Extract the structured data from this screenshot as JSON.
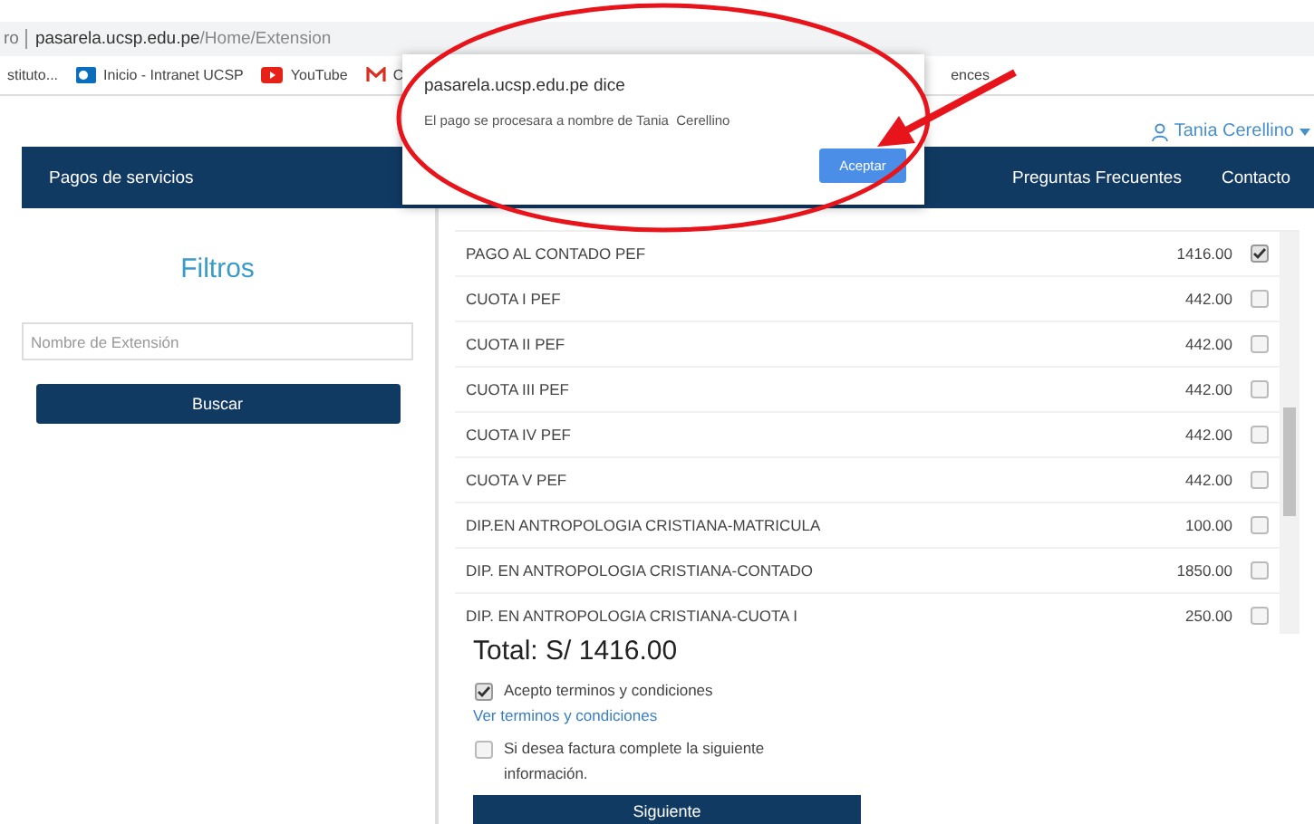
{
  "browser": {
    "tab_fragment": "ro",
    "url_host": "pasarela.ucsp.edu.pe",
    "url_path": "/Home/Extension",
    "bookmarks": [
      {
        "label": "stituto...",
        "kind": "plain"
      },
      {
        "label": "Inicio - Intranet UCSP",
        "kind": "intranet"
      },
      {
        "label": "YouTube",
        "kind": "youtube"
      },
      {
        "label": "C",
        "kind": "gmail"
      },
      {
        "label": "ences",
        "kind": "plain"
      }
    ]
  },
  "user": {
    "name": "Tania Cerellino"
  },
  "nav": {
    "left": "Pagos de servicios",
    "right": [
      "Preguntas Frecuentes",
      "Contacto"
    ]
  },
  "filters": {
    "title": "Filtros",
    "search": {
      "placeholder": "Nombre de Extensión"
    },
    "button": "Buscar"
  },
  "items": [
    {
      "name": "PAGO AL CONTADO PEF",
      "amount": "1416.00",
      "checked": true
    },
    {
      "name": "CUOTA I PEF",
      "amount": "442.00",
      "checked": false
    },
    {
      "name": "CUOTA II PEF",
      "amount": "442.00",
      "checked": false
    },
    {
      "name": "CUOTA III PEF",
      "amount": "442.00",
      "checked": false
    },
    {
      "name": "CUOTA IV PEF",
      "amount": "442.00",
      "checked": false
    },
    {
      "name": "CUOTA V PEF",
      "amount": "442.00",
      "checked": false
    },
    {
      "name": "DIP.EN ANTROPOLOGIA CRISTIANA-MATRICULA",
      "amount": "100.00",
      "checked": false
    },
    {
      "name": "DIP. EN ANTROPOLOGIA CRISTIANA-CONTADO",
      "amount": "1850.00",
      "checked": false
    },
    {
      "name": "DIP. EN ANTROPOLOGIA CRISTIANA-CUOTA I",
      "amount": "250.00",
      "checked": false
    }
  ],
  "total": "Total: S/ 1416.00",
  "terms": {
    "label": "Acepto terminos y condiciones",
    "checked": true,
    "link": "Ver terminos y condiciones"
  },
  "invoice": {
    "label": "Si desea factura complete la siguiente información.",
    "checked": false
  },
  "next_button": "Siguiente",
  "dialog": {
    "title": "pasarela.ucsp.edu.pe dice",
    "message": "El pago se procesara a nombre de Tania  Cerellino",
    "button": "Aceptar"
  }
}
